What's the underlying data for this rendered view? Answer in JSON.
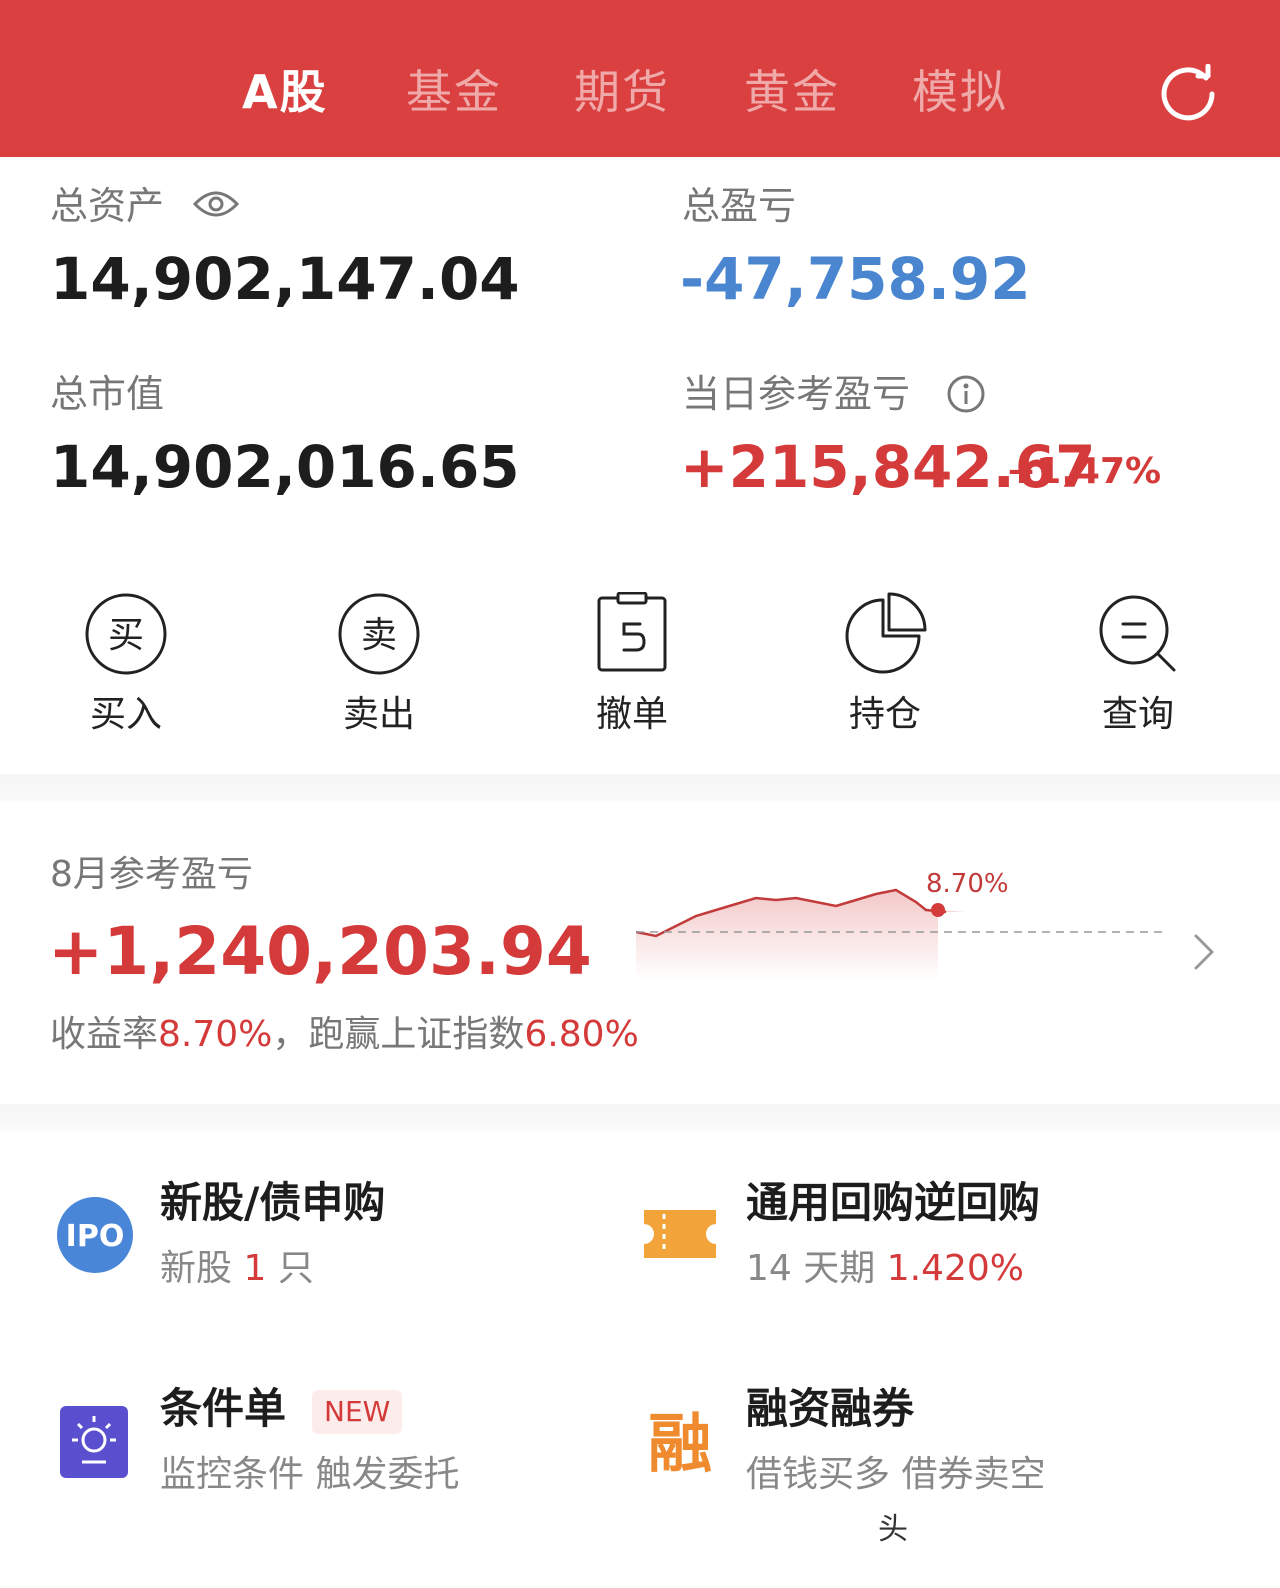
{
  "tabs": [
    {
      "label": "A股",
      "active": true
    },
    {
      "label": "基金",
      "active": false
    },
    {
      "label": "期货",
      "active": false
    },
    {
      "label": "黄金",
      "active": false
    },
    {
      "label": "模拟",
      "active": false
    }
  ],
  "summary": {
    "total_assets_label": "总资产",
    "total_assets_value": "14,902,147.04",
    "total_pl_label": "总盈亏",
    "total_pl_value": "-47,758.92",
    "market_value_label": "总市值",
    "market_value_value": "14,902,016.65",
    "daily_pl_label": "当日参考盈亏",
    "daily_pl_value": "+215,842.67",
    "daily_pl_pct": "+1.47%"
  },
  "actions": [
    {
      "label": "买入",
      "icon_char": "买"
    },
    {
      "label": "卖出",
      "icon_char": "卖"
    },
    {
      "label": "撤单"
    },
    {
      "label": "持仓"
    },
    {
      "label": "查询"
    }
  ],
  "monthly": {
    "label": "8月参考盈亏",
    "value": "+1,240,203.94",
    "rate_prefix": "收益率",
    "rate_value": "8.70%",
    "beat_prefix": "，跑赢上证指数",
    "beat_value": "6.80%",
    "spark_end_label": "8.70%"
  },
  "features": {
    "ipo": {
      "icon_text": "IPO",
      "title": "新股/债申购",
      "sub_prefix": "新股",
      "sub_count": "1",
      "sub_suffix": "只"
    },
    "repo": {
      "title": "通用回购逆回购",
      "sub_prefix": "14 天期",
      "sub_rate": "1.420%"
    },
    "conditional": {
      "title": "条件单",
      "badge": "NEW",
      "sub": "监控条件 触发委托"
    },
    "margin": {
      "icon_text": "融",
      "title": "融资融券",
      "sub": "借钱买多 借券卖空"
    }
  },
  "colors": {
    "header_red": "#db4040",
    "gain_red": "#d43a3a",
    "loss_blue": "#4a86d0",
    "ipo_blue": "#4a86d8",
    "ticket_orange": "#f2a33a",
    "condition_purple": "#5a4fcf",
    "margin_orange": "#ef8a2e"
  },
  "watermark": "头"
}
